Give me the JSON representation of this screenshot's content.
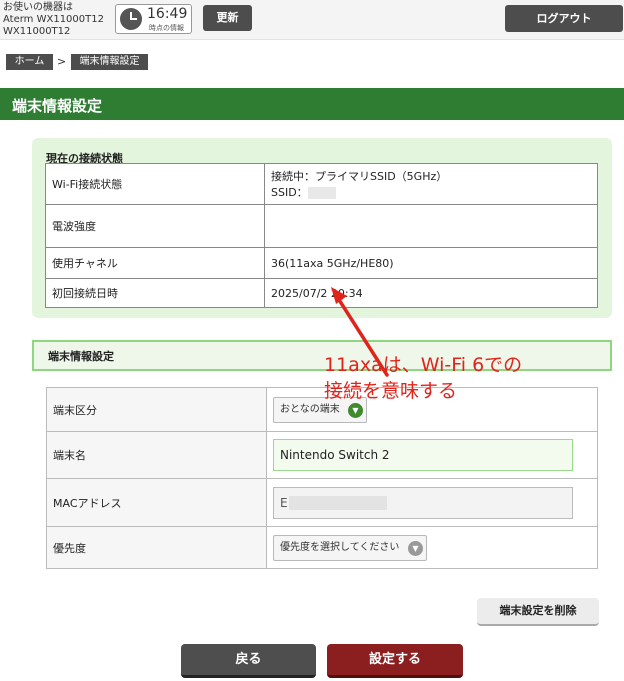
{
  "header": {
    "device_label": "お使いの機器は",
    "device_model": "Aterm WX11000T12",
    "device_model2": "WX11000T12",
    "clock_time": "16:49",
    "clock_label": "時点の情報",
    "update_label": "更新",
    "logout_label": "ログアウト"
  },
  "breadcrumb": {
    "home": "ホーム",
    "separator": ">",
    "current": "端末情報設定"
  },
  "page_title": "端末情報設定",
  "connection": {
    "heading": "現在の接続状態",
    "rows": {
      "wifi_status": {
        "label": "Wi-Fi接続状態",
        "value_line1": "接続中：プライマリSSID（5GHz）",
        "value_line2": "SSID："
      },
      "signal": {
        "label": "電波強度",
        "value": ""
      },
      "channel": {
        "label": "使用チャネル",
        "value": "36(11axa 5GHz/HE80)"
      },
      "first_connect": {
        "label": "初回接続日時",
        "value": "2025/07/2  20:34"
      }
    }
  },
  "settings": {
    "heading": "端末情報設定",
    "rows": {
      "category": {
        "label": "端末区分",
        "value": "おとなの端末"
      },
      "name": {
        "label": "端末名",
        "value": "Nintendo Switch 2"
      },
      "mac": {
        "label": "MACアドレス",
        "value": "E"
      },
      "priority": {
        "label": "優先度",
        "placeholder": "優先度を選択してください"
      }
    }
  },
  "buttons": {
    "delete": "端末設定を削除",
    "back": "戻る",
    "submit": "設定する"
  },
  "annotation": {
    "line1": "11axaは、Wi-Fi 6での",
    "line2": "接続を意味する"
  },
  "colors": {
    "title_bar": "#2e7d32",
    "panel": "#e3f6dd",
    "annotation": "#e0241b",
    "submit": "#8b1e1e",
    "dark_button": "#4e4e4e"
  },
  "icons": [
    "clock-icon",
    "chevron-down-icon",
    "arrow-annotation"
  ]
}
